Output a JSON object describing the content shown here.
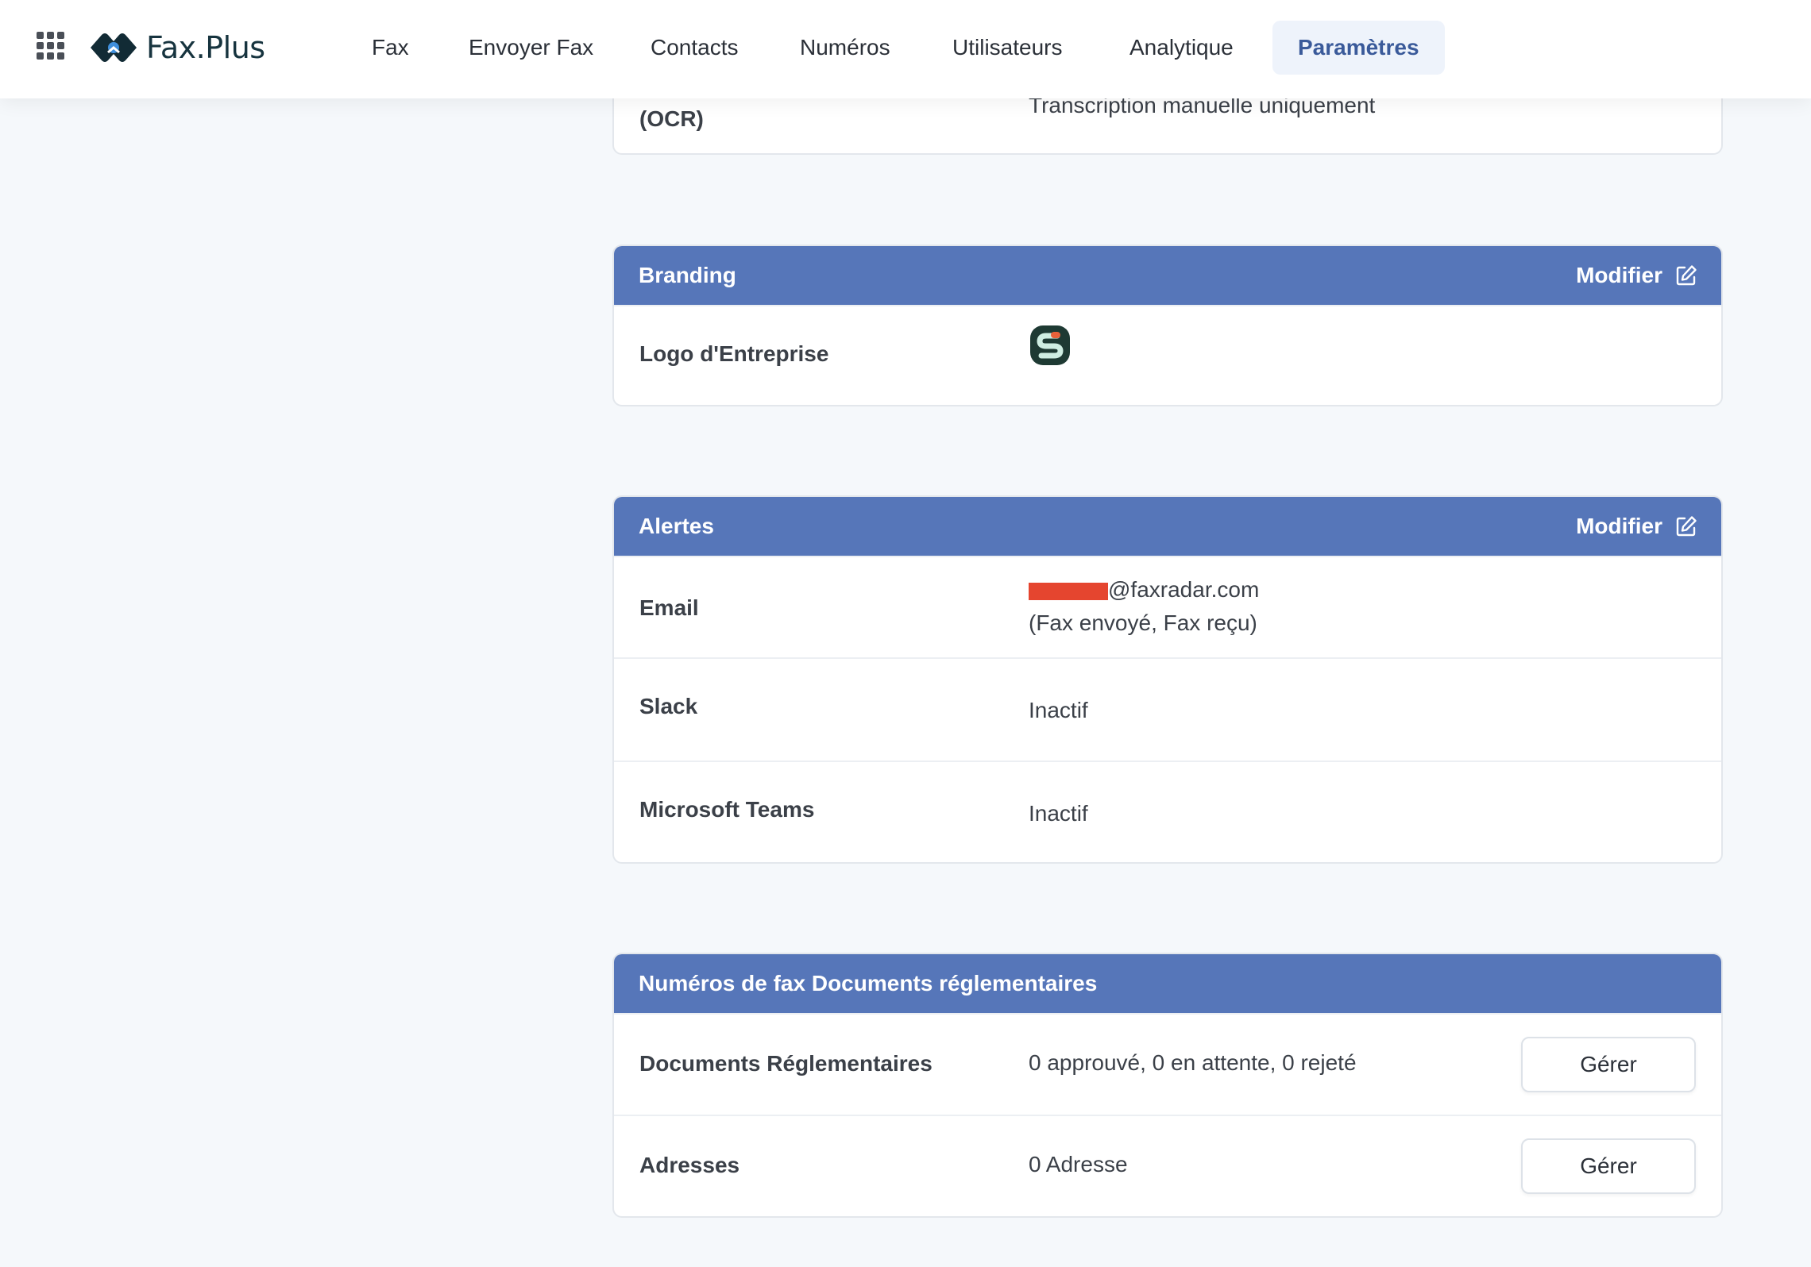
{
  "header": {
    "brand": "Fax.Plus",
    "nav": [
      {
        "label": "Fax"
      },
      {
        "label": "Envoyer Fax"
      },
      {
        "label": "Contacts"
      },
      {
        "label": "Numéros"
      },
      {
        "label": "Utilisateurs"
      },
      {
        "label": "Analytique"
      },
      {
        "label": "Paramètres",
        "active": true
      }
    ]
  },
  "ocr_card": {
    "label_fragment": "(OCR)",
    "value": "Transcription manuelle uniquement"
  },
  "branding_card": {
    "title": "Branding",
    "action": "Modifier",
    "rows": [
      {
        "label": "Logo d'Entreprise",
        "value_type": "logo-image"
      }
    ]
  },
  "alerts_card": {
    "title": "Alertes",
    "action": "Modifier",
    "rows": [
      {
        "label": "Email",
        "value_line1": "@faxradar.com",
        "value_line2": "(Fax envoyé, Fax reçu)"
      },
      {
        "label": "Slack",
        "value": "Inactif"
      },
      {
        "label": "Microsoft Teams",
        "value": "Inactif"
      }
    ]
  },
  "regulatory_card": {
    "title": "Numéros de fax Documents réglementaires",
    "rows": [
      {
        "label": "Documents Réglementaires",
        "value": "0 approuvé, 0 en attente, 0 rejeté",
        "button": "Gérer"
      },
      {
        "label": "Adresses",
        "value": "0 Adresse",
        "button": "Gérer"
      }
    ]
  },
  "colors": {
    "card_header": "#5676b9",
    "active_nav_bg": "#eef3fb",
    "active_nav_text": "#3a5a9a",
    "redaction": "#e5452f",
    "logo_dark": "#1e3a33"
  },
  "icons": [
    "apps-grid-icon",
    "fax-plus-logo",
    "edit-icon",
    "company-logo"
  ]
}
